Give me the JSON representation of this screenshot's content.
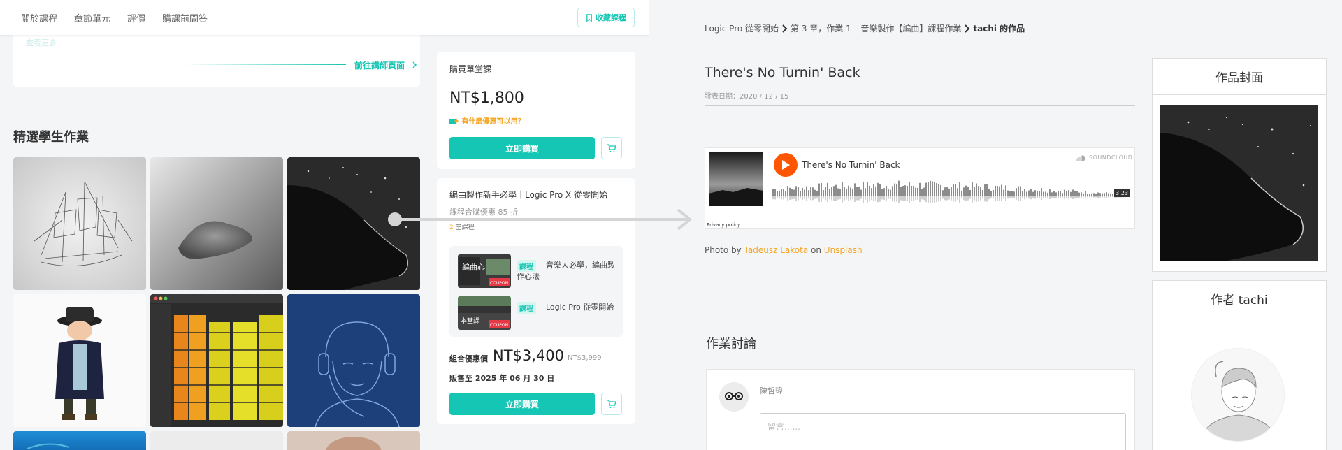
{
  "left": {
    "nav": {
      "tabs": [
        "關於課程",
        "章節單元",
        "評價",
        "購課前問答"
      ],
      "favorite_label": "收藏課程"
    },
    "instructor": {
      "more_label": "查看更多",
      "goto_label": "前往講師頁面"
    },
    "gallery_title": "精選學生作業",
    "purchase": {
      "label": "購買單堂課",
      "price": "NT$1,800",
      "discount_link": "有什麼優惠可以用？",
      "buy_label": "立即購買"
    },
    "bundle": {
      "title": "編曲製作新手必學｜Logic Pro X 從零開始",
      "discount_text": "課程合購優惠 85 折",
      "count_num": "2",
      "count_suffix": " 堂課程",
      "items": [
        {
          "tag": "課程",
          "name": "音樂人必學，編曲製作心法",
          "thumb_text": "編曲心法",
          "coupon": "COUPON"
        },
        {
          "tag": "課程",
          "name": "Logic Pro 從零開始",
          "thumb_text": "本堂課",
          "coupon": "COUPON"
        }
      ],
      "combo_label": "組合優惠價",
      "combo_price": "NT$3,400",
      "combo_old": "NT$3,999",
      "sale_until": "販售至 2025 年 06 月 30 日",
      "buy_label": "立即購買"
    }
  },
  "right": {
    "breadcrumb": {
      "course": "Logic Pro 從零開始",
      "chapter": "第 3 章，作業 1 – 音樂製作【編曲】課程作業",
      "current": "tachi 的作品"
    },
    "work": {
      "title": "There's No Turnin' Back",
      "date": "發表日期：2020 / 12 / 15"
    },
    "player": {
      "track": "There's No Turnin' Back",
      "brand": "SOUNDCLOUD",
      "duration": "3:23",
      "privacy": "Privacy policy"
    },
    "credit": {
      "prefix": "Photo by ",
      "photographer": "Tadeusz Lakota",
      "middle": " on ",
      "site": "Unsplash"
    },
    "discussion": {
      "title": "作業討論",
      "username": "陳哲瑋",
      "placeholder": "留言......"
    },
    "sidebar": {
      "cover_title": "作品封面",
      "author_title": "作者 tachi"
    }
  },
  "colors": {
    "accent": "#14c6b3",
    "orange": "#f5a623",
    "soundcloud": "#ff5500"
  }
}
